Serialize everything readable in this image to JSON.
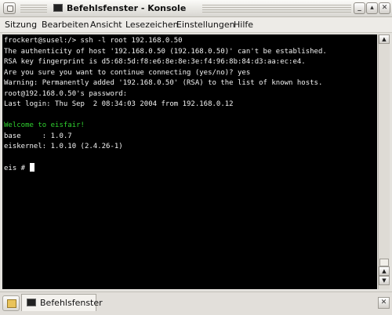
{
  "window": {
    "title": "Befehlsfenster - Konsole",
    "min_glyph": "_",
    "max_glyph": "▴",
    "close_glyph": "✕"
  },
  "menu": {
    "items": [
      "Sitzung",
      "Bearbeiten",
      "Ansicht",
      "Lesezeichen",
      "Einstellungen",
      "Hilfe"
    ]
  },
  "terminal": {
    "lines": [
      {
        "text": "frockert@susel:/> ssh -l root 192.168.0.50",
        "color": "#f2f2f2"
      },
      {
        "text": "The authenticity of host '192.168.0.50 (192.168.0.50)' can't be established.",
        "color": "#f2f2f2"
      },
      {
        "text": "RSA key fingerprint is d5:68:5d:f8:e6:8e:8e:3e:f4:96:8b:84:d3:aa:ec:e4.",
        "color": "#f2f2f2"
      },
      {
        "text": "Are you sure you want to continue connecting (yes/no)? yes",
        "color": "#f2f2f2"
      },
      {
        "text": "Warning: Permanently added '192.168.0.50' (RSA) to the list of known hosts.",
        "color": "#f2f2f2"
      },
      {
        "text": "root@192.168.0.50's password:",
        "color": "#f2f2f2"
      },
      {
        "text": "Last login: Thu Sep  2 08:34:03 2004 from 192.168.0.12",
        "color": "#f2f2f2"
      },
      {
        "text": "",
        "color": "#f2f2f2"
      },
      {
        "text": "Welcome to eisfair!",
        "color": "#2fd12f"
      },
      {
        "text": "base     : 1.0.7",
        "color": "#f2f2f2"
      },
      {
        "text": "eiskernel: 1.0.10 (2.4.26-1)",
        "color": "#f2f2f2"
      },
      {
        "text": "",
        "color": "#f2f2f2"
      },
      {
        "text": "eis # ",
        "color": "#f2f2f2"
      }
    ]
  },
  "scrollbar": {
    "up_glyph": "▲",
    "down_glyph": "▼"
  },
  "tabs": {
    "items": [
      {
        "label": "Befehlsfenster"
      }
    ],
    "close_glyph": "✕"
  },
  "colors": {
    "terminal_bg": "#000000",
    "terminal_fg": "#f2f2f2",
    "welcome_green": "#2fd12f"
  }
}
